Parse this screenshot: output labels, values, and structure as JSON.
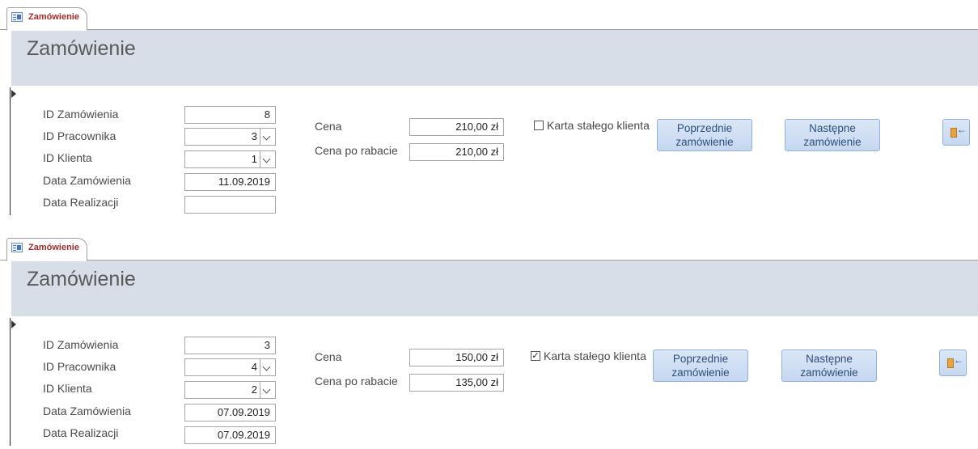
{
  "forms": [
    {
      "tab_label": "Zamówienie",
      "header_title": "Zamówienie",
      "labels": {
        "id_zamowienia": "ID Zamówienia",
        "id_pracownika": "ID Pracownika",
        "id_klienta": "ID Klienta",
        "data_zamowienia": "Data Zamówienia",
        "data_realizacji": "Data Realizacji",
        "cena": "Cena",
        "cena_po_rabacie": "Cena po rabacie",
        "karta": "Karta stałego klienta"
      },
      "values": {
        "id_zamowienia": "8",
        "id_pracownika": "3",
        "id_klienta": "1",
        "data_zamowienia": "11.09.2019",
        "data_realizacji": "",
        "cena": "210,00 zł",
        "cena_po_rabacie": "210,00 zł",
        "karta_checked": false,
        "karta_mark": ""
      },
      "buttons": {
        "prev_line1": "Poprzednie",
        "prev_line2": "zamówienie",
        "next_line1": "Następne",
        "next_line2": "zamówienie",
        "exit_icon": "exit-door-icon"
      }
    },
    {
      "tab_label": "Zamówienie",
      "header_title": "Zamówienie",
      "labels": {
        "id_zamowienia": "ID Zamówienia",
        "id_pracownika": "ID Pracownika",
        "id_klienta": "ID Klienta",
        "data_zamowienia": "Data Zamówienia",
        "data_realizacji": "Data Realizacji",
        "cena": "Cena",
        "cena_po_rabacie": "Cena po rabacie",
        "karta": "Karta stałego klienta"
      },
      "values": {
        "id_zamowienia": "3",
        "id_pracownika": "4",
        "id_klienta": "2",
        "data_zamowienia": "07.09.2019",
        "data_realizacji": "07.09.2019",
        "cena": "150,00 zł",
        "cena_po_rabacie": "135,00 zł",
        "karta_checked": true,
        "karta_mark": "✓"
      },
      "buttons": {
        "prev_line1": "Poprzednie",
        "prev_line2": "zamówienie",
        "next_line1": "Następne",
        "next_line2": "zamówienie",
        "exit_icon": "exit-door-icon"
      }
    }
  ],
  "colors": {
    "header_band": "#d8dee8",
    "tab_label": "#a52a2a",
    "button_fill": "#c5d7f0",
    "button_text": "#2e4f7a"
  }
}
